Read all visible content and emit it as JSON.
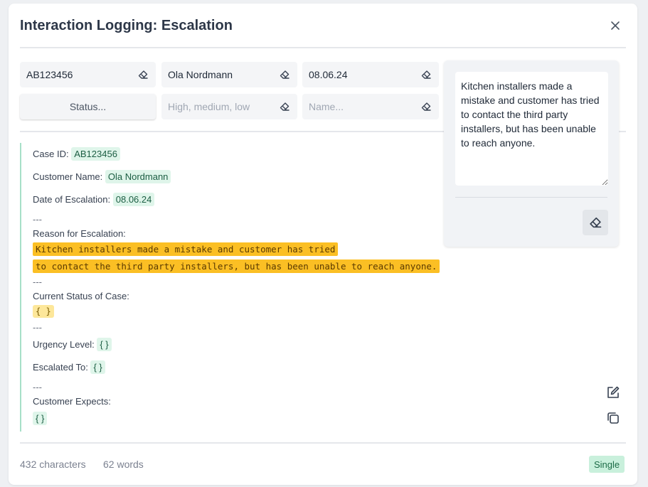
{
  "header": {
    "title": "Interaction Logging: Escalation"
  },
  "fields": {
    "case_id": {
      "value": "AB123456"
    },
    "customer_name": {
      "value": "Ola Nordmann"
    },
    "date": {
      "value": "08.06.24"
    },
    "status": {
      "label": "Status..."
    },
    "urgency": {
      "placeholder": "High, medium, low"
    },
    "escalated_to": {
      "placeholder": "Name..."
    }
  },
  "preview": {
    "case_id_label": "Case ID:",
    "case_id_value": "AB123456",
    "customer_name_label": "Customer Name:",
    "customer_name_value": "Ola Nordmann",
    "date_label": "Date of Escalation:",
    "date_value": "08.06.24",
    "separator": "---",
    "reason_label": "Reason for Escalation:",
    "reason_line_1": "Kitchen installers made a mistake and customer has tried",
    "reason_line_2": "to contact the third party installers, but has been unable to reach anyone.",
    "status_label": "Current Status of Case:",
    "status_value": "{ }",
    "urgency_label": "Urgency Level:",
    "urgency_value": "{ }",
    "escalated_label": "Escalated To:",
    "escalated_value": "{ }",
    "expects_label": "Customer Expects:",
    "expects_value": "{ }"
  },
  "panel": {
    "text": "Kitchen installers made a mistake and customer has tried\nto contact the third party installers, but has been unable to reach anyone."
  },
  "footer": {
    "characters": "432 characters",
    "words": "62 words",
    "mode_badge": "Single"
  },
  "icons": {
    "close": "close-icon",
    "eraser": "eraser-icon",
    "edit": "edit-icon",
    "copy": "copy-icon"
  },
  "colors": {
    "accent": "#1c6b46",
    "chip_bg": "#dff5ea",
    "highlight": "#fbbf24",
    "placeholder_highlight": "#fde79a"
  }
}
